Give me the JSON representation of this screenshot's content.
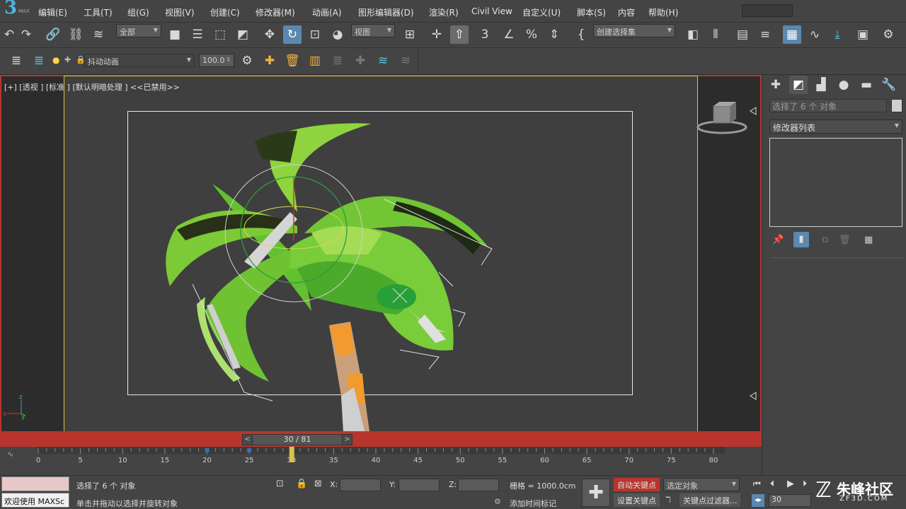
{
  "app": {
    "logo_text": "3",
    "logo_sub": "MAX"
  },
  "menu": [
    "编辑(E)",
    "工具(T)",
    "组(G)",
    "视图(V)",
    "创建(C)",
    "修改器(M)",
    "动画(A)",
    "图形编辑器(D)",
    "渲染(R)",
    "Civil View",
    "自定义(U)",
    "脚本(S)",
    "内容",
    "帮助(H)"
  ],
  "toolbar1": {
    "filter_dropdown": "全部",
    "coord_dropdown": "视图",
    "selection_set": "创建选择集",
    "icons": [
      "undo-icon",
      "redo-icon",
      "link-icon",
      "unlink-icon",
      "bind-spacewarp-icon",
      "select-object-icon",
      "select-by-name-icon",
      "rect-select-icon",
      "window-crossing-icon",
      "move-icon",
      "rotate-icon",
      "scale-icon",
      "place-icon",
      "pivot-icon",
      "select-manipulate-icon",
      "snap-3d-icon",
      "angle-snap-icon",
      "percent-snap-icon",
      "spinner-snap-icon",
      "edit-named-sets-icon",
      "mirror-icon",
      "align-icon",
      "layer-explorer-icon",
      "toggle-ribbon-icon",
      "scene-explorer-icon",
      "curve-editor-icon",
      "dope-sheet-icon",
      "schematic-icon",
      "render-setup-icon"
    ]
  },
  "toolbar2": {
    "layer_name": "抖动动画",
    "value": "100.0"
  },
  "viewport": {
    "label": "[+] [透视 ] [标准 ] [默认明暗处理 ] <<已禁用>>",
    "axis_z": "z",
    "axis_x": "x",
    "axis_y": "y"
  },
  "time": {
    "frame_display": "30 / 81",
    "prev": "<",
    "next": ">",
    "current_frame": 30,
    "total_frames": 81,
    "ticks": [
      "0",
      "5",
      "10",
      "15",
      "20",
      "25",
      "30",
      "35",
      "40",
      "45",
      "50",
      "55",
      "60",
      "65",
      "70",
      "75",
      "80"
    ]
  },
  "command_panel": {
    "tabs": [
      "create-tab-icon",
      "modify-tab-icon",
      "hierarchy-tab-icon",
      "motion-tab-icon",
      "display-tab-icon",
      "utilities-tab-icon"
    ],
    "selection_text": "选择了 6 个 对象",
    "modifier_list": "修改器列表"
  },
  "status": {
    "welcome": "欢迎使用 MAXSc",
    "selected": "选择了 6 个 对象",
    "hint": "单击并拖动以选择并旋转对象",
    "x_label": "X:",
    "y_label": "Y:",
    "z_label": "Z:",
    "grid": "栅格 = 1000.0cm",
    "add_time_tag": "添加时间标记",
    "auto_key": "自动关键点",
    "set_key": "设置关键点",
    "selected_object": "选定对象",
    "key_filters": "关键点过滤器...",
    "frame_field": "30"
  },
  "watermark": {
    "main": "朱峰社区",
    "sub": "ZF3D.COM"
  },
  "colors": {
    "accent_red": "#b8352e",
    "safe_frame": "#e0c14a",
    "active_blue": "#5a88b0"
  }
}
